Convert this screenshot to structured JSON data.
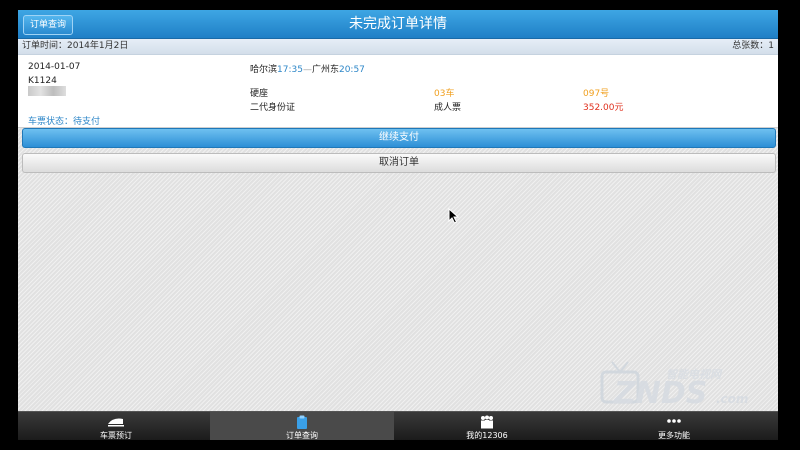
{
  "header": {
    "back_label": "订单查询",
    "title": "未完成订单详情"
  },
  "infobar": {
    "order_time": "订单时间：2014年1月2日",
    "total_tickets": "总张数：1"
  },
  "order": {
    "date": "2014-01-07",
    "train_no": "K1124",
    "status_label": "车票状态",
    "status_value": "：待支付",
    "from_station": "哈尔滨",
    "depart_time": "17:35",
    "separator": "—",
    "to_station": "广州东",
    "arrive_time": "20:57",
    "seat_type": "硬座",
    "coach": "03车",
    "seat_no": "097号",
    "id_type": "二代身份证",
    "ticket_type": "成人票",
    "price": "352.00元"
  },
  "actions": {
    "continue_pay": "继续支付",
    "cancel_order": "取消订单"
  },
  "watermark": {
    "top_text": "智能电视网",
    "main_text": "ZNDS",
    "suffix": ".com"
  },
  "bottom_nav": {
    "items": [
      {
        "label": "车票预订",
        "icon": "train-icon"
      },
      {
        "label": "订单查询",
        "icon": "clipboard-icon"
      },
      {
        "label": "我的12306",
        "icon": "people-icon"
      },
      {
        "label": "更多功能",
        "icon": "more-dots-icon"
      }
    ],
    "active_index": 1
  },
  "colors": {
    "titlebar": "#2a8ad0",
    "accent_blue": "#2e87c8",
    "orange": "#f0a020",
    "price_red": "#e0301e"
  }
}
